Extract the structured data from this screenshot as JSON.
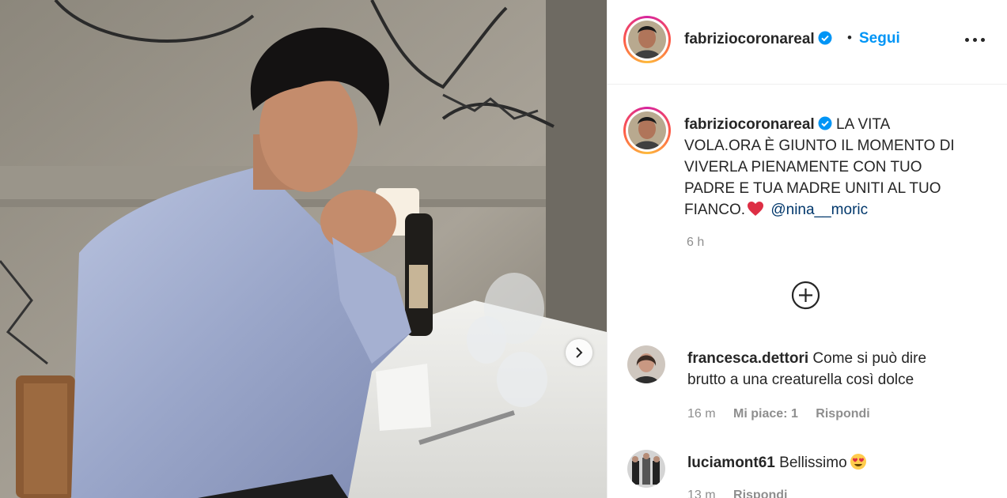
{
  "post": {
    "author": "fabriziocoronareal",
    "follow_separator": "•",
    "follow_label": "Segui",
    "more_icon": "more-horizontal-icon",
    "caption": {
      "text": "LA VITA VOLA.ORA È GIUNTO IL MOMENTO DI VIVERLA PIENAMENTE CON TUO PADRE E TUA MADRE UNITI AL TUO FIANCO.",
      "emoji": "red-heart-emoji",
      "mention": "@nina__moric"
    },
    "time": "6 h",
    "load_more_icon": "plus-circle-icon"
  },
  "comments": [
    {
      "username": "francesca.dettori",
      "text": "Come si può dire brutto a una creaturella così dolce",
      "time": "16 m",
      "likes": "Mi piace: 1",
      "reply": "Rispondi"
    },
    {
      "username": "luciamont61",
      "text": "Bellissimo",
      "emoji": "heart-eyes-emoji",
      "time": "13 m",
      "reply": "Rispondi"
    }
  ],
  "colors": {
    "link_blue": "#0095f6",
    "mention_blue": "#00376b",
    "secondary_text": "#8e8e8e",
    "heart_red": "#ed4956"
  }
}
